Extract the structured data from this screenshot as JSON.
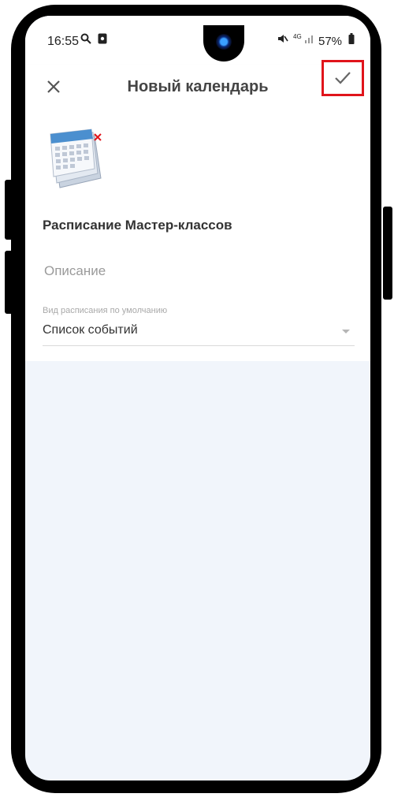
{
  "status_bar": {
    "time": "16:55",
    "battery": "57%",
    "network": "4G"
  },
  "app_bar": {
    "title": "Новый календарь",
    "close_icon": "close-icon",
    "save_icon": "checkmark-icon"
  },
  "form": {
    "calendar_name": "Расписание Мастер-классов",
    "description_placeholder": "Описание",
    "default_view_label": "Вид расписания по умолчанию",
    "default_view_value": "Список событий"
  },
  "colors": {
    "highlight": "#e0141b",
    "background": "#f1f5fb"
  }
}
